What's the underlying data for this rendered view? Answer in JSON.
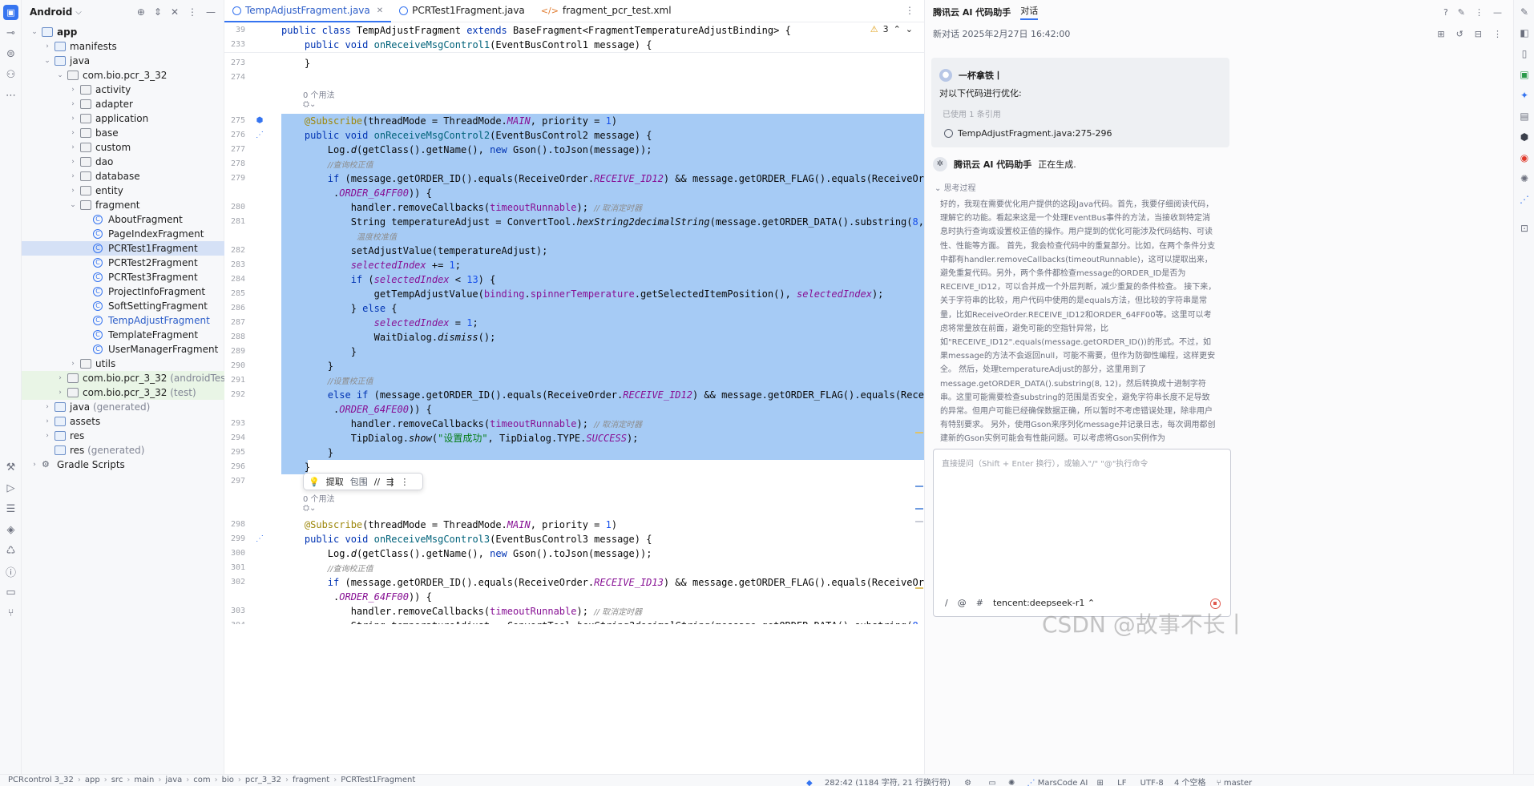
{
  "project": {
    "view_label": "Android",
    "tree": [
      {
        "label": "app",
        "level": 0,
        "kind": "folder",
        "expanded": true,
        "bold": true
      },
      {
        "label": "manifests",
        "level": 1,
        "kind": "folder",
        "expanded": false
      },
      {
        "label": "java",
        "level": 1,
        "kind": "folder",
        "expanded": true
      },
      {
        "label": "com.bio.pcr_3_32",
        "level": 2,
        "kind": "pkg",
        "expanded": true
      },
      {
        "label": "activity",
        "level": 3,
        "kind": "pkg",
        "expanded": false
      },
      {
        "label": "adapter",
        "level": 3,
        "kind": "pkg",
        "expanded": false
      },
      {
        "label": "application",
        "level": 3,
        "kind": "pkg",
        "expanded": false
      },
      {
        "label": "base",
        "level": 3,
        "kind": "pkg",
        "expanded": false
      },
      {
        "label": "custom",
        "level": 3,
        "kind": "pkg",
        "expanded": false
      },
      {
        "label": "dao",
        "level": 3,
        "kind": "pkg",
        "expanded": false
      },
      {
        "label": "database",
        "level": 3,
        "kind": "pkg",
        "expanded": false
      },
      {
        "label": "entity",
        "level": 3,
        "kind": "pkg",
        "expanded": false
      },
      {
        "label": "fragment",
        "level": 3,
        "kind": "pkg",
        "expanded": true
      },
      {
        "label": "AboutFragment",
        "level": 4,
        "kind": "class"
      },
      {
        "label": "PageIndexFragment",
        "level": 4,
        "kind": "class"
      },
      {
        "label": "PCRTest1Fragment",
        "level": 4,
        "kind": "class",
        "selected": true
      },
      {
        "label": "PCRTest2Fragment",
        "level": 4,
        "kind": "class"
      },
      {
        "label": "PCRTest3Fragment",
        "level": 4,
        "kind": "class"
      },
      {
        "label": "ProjectInfoFragment",
        "level": 4,
        "kind": "class"
      },
      {
        "label": "SoftSettingFragment",
        "level": 4,
        "kind": "class"
      },
      {
        "label": "TempAdjustFragment",
        "level": 4,
        "kind": "class",
        "blue": true
      },
      {
        "label": "TemplateFragment",
        "level": 4,
        "kind": "class"
      },
      {
        "label": "UserManagerFragment",
        "level": 4,
        "kind": "class"
      },
      {
        "label": "utils",
        "level": 3,
        "kind": "pkg",
        "expanded": false
      },
      {
        "label": "com.bio.pcr_3_32",
        "suffix": "(androidTest)",
        "level": 2,
        "kind": "pkg",
        "expanded": false,
        "green": true
      },
      {
        "label": "com.bio.pcr_3_32",
        "suffix": "(test)",
        "level": 2,
        "kind": "pkg",
        "expanded": false,
        "green": true
      },
      {
        "label": "java",
        "suffix": "(generated)",
        "level": 1,
        "kind": "folder",
        "expanded": false
      },
      {
        "label": "assets",
        "level": 1,
        "kind": "folder",
        "expanded": false
      },
      {
        "label": "res",
        "level": 1,
        "kind": "folder",
        "expanded": false
      },
      {
        "label": "res",
        "suffix": "(generated)",
        "level": 1,
        "kind": "folder",
        "noarrow": true
      },
      {
        "label": "Gradle Scripts",
        "level": 0,
        "kind": "gradle",
        "expanded": false
      }
    ]
  },
  "editor": {
    "tabs": [
      {
        "label": "TempAdjustFragment.java",
        "active": true,
        "icon": "class"
      },
      {
        "label": "PCRTest1Fragment.java",
        "active": false,
        "icon": "class"
      },
      {
        "label": "fragment_pcr_test.xml",
        "active": false,
        "icon": "xml"
      }
    ],
    "warnings": "3",
    "sticky": [
      {
        "ln": "39",
        "html": "<span class=\"k\">public class</span> TempAdjustFragment <span class=\"k\">extends</span> BaseFragment&lt;FragmentTemperatureAdjustBinding&gt; {"
      },
      {
        "ln": "233",
        "html": "    <span class=\"k\">public void</span> <span class=\"f\">onReceiveMsgControl1</span>(EventBusControl1 message) {"
      }
    ],
    "usage_hint": "0 个用法",
    "popup": {
      "extract": "提取",
      "surround": "包围"
    },
    "lines": [
      {
        "ln": "273",
        "html": "    }"
      },
      {
        "ln": "274",
        "html": ""
      },
      {
        "ln": "275",
        "html": "    <span class=\"a\">@Subscribe</span>(threadMode = ThreadMode.<span class=\"pu\">MAIN</span>, priority = <span class=\"n\">1</span>)"
      },
      {
        "ln": "276",
        "html": "    <span class=\"k\">public void</span> <span class=\"f\">onReceiveMsgControl2</span>(EventBusControl2 message) {"
      },
      {
        "ln": "277",
        "html": "        Log.<span class=\"it\">d</span>(getClass().getName(), <span class=\"k\">new</span> Gson().toJson(message));"
      },
      {
        "ln": "278",
        "html": "        <span class=\"cmz\">//查询校正值</span>"
      },
      {
        "ln": "279",
        "html": "        <span class=\"k\">if</span> (message.getORDER_ID().equals(ReceiveOrder.<span class=\"pu\">RECEIVE_ID12</span>) &amp;&amp; message.getORDER_FLAG().equals(ReceiveOrder"
      },
      {
        "ln": "",
        "html": "         .<span class=\"pu\">ORDER_64FF00</span>)) {"
      },
      {
        "ln": "280",
        "html": "            handler.removeCallbacks(<span class=\"pu\" style=\"font-style:normal\">timeoutRunnable</span>); <span class=\"cmz\">// 取消定时器</span>"
      },
      {
        "ln": "281",
        "html": "            String temperatureAdjust = ConvertTool.<span class=\"it\">hexString2decimalString</span>(message.getORDER_DATA().substring(<span class=\"n\">8</span>, <span class=\"n\">12</span>));<span class=\"cm\">//</span>"
      },
      {
        "ln": "",
        "html": "             <span class=\"cmz\">温度校准值</span>"
      },
      {
        "ln": "282",
        "html": "            setAdjustValue(temperatureAdjust);"
      },
      {
        "ln": "283",
        "html": "            <span class=\"pu\">selectedIndex</span> += <span class=\"n\">1</span>;"
      },
      {
        "ln": "284",
        "html": "            <span class=\"k\">if</span> (<span class=\"pu\">selectedIndex</span> &lt; <span class=\"n\">13</span>) {"
      },
      {
        "ln": "285",
        "html": "                getTempAdjustValue(<span class=\"pu\" style=\"font-style:normal\">binding</span>.<span class=\"pu\" style=\"font-style:normal\">spinnerTemperature</span>.getSelectedItemPosition(), <span class=\"pu\">selectedIndex</span>);"
      },
      {
        "ln": "286",
        "html": "            } <span class=\"k\">else</span> {"
      },
      {
        "ln": "287",
        "html": "                <span class=\"pu\">selectedIndex</span> = <span class=\"n\">1</span>;"
      },
      {
        "ln": "288",
        "html": "                WaitDialog.<span class=\"it\">dismiss</span>();"
      },
      {
        "ln": "289",
        "html": "            }"
      },
      {
        "ln": "290",
        "html": "        }"
      },
      {
        "ln": "291",
        "html": "        <span class=\"cmz\">//设置校正值</span>"
      },
      {
        "ln": "292",
        "html": "        <span class=\"k\">else if</span> (message.getORDER_ID().equals(ReceiveOrder.<span class=\"pu\">RECEIVE_ID12</span>) &amp;&amp; message.getORDER_FLAG().equals(ReceiveOrder"
      },
      {
        "ln": "",
        "html": "         .<span class=\"pu\">ORDER_64FE00</span>)) {"
      },
      {
        "ln": "293",
        "html": "            handler.removeCallbacks(<span class=\"pu\" style=\"font-style:normal\">timeoutRunnable</span>); <span class=\"cmz\">// 取消定时器</span>"
      },
      {
        "ln": "294",
        "html": "            TipDialog.<span class=\"it\">show</span>(<span class=\"s\">\"设置成功\"</span>, TipDialog.TYPE.<span class=\"pu\">SUCCESS</span>);"
      },
      {
        "ln": "295",
        "html": "        }"
      },
      {
        "ln": "296",
        "html": "    }"
      },
      {
        "ln": "297",
        "html": ""
      },
      {
        "ln": "298",
        "html": "    <span class=\"a\">@Subscribe</span>(threadMode = ThreadMode.<span class=\"pu\">MAIN</span>, priority = <span class=\"n\">1</span>)"
      },
      {
        "ln": "299",
        "html": "    <span class=\"k\">public void</span> <span class=\"f\">onReceiveMsgControl3</span>(EventBusControl3 message) {"
      },
      {
        "ln": "300",
        "html": "        Log.<span class=\"it\">d</span>(getClass().getName(), <span class=\"k\">new</span> Gson().toJson(message));"
      },
      {
        "ln": "301",
        "html": "        <span class=\"cmz\">//查询校正值</span>"
      },
      {
        "ln": "302",
        "html": "        <span class=\"k\">if</span> (message.getORDER_ID().equals(ReceiveOrder.<span class=\"pu\">RECEIVE_ID13</span>) &amp;&amp; message.getORDER_FLAG().equals(ReceiveOrder"
      },
      {
        "ln": "",
        "html": "         .<span class=\"pu\">ORDER_64FF00</span>)) {"
      },
      {
        "ln": "303",
        "html": "            handler.removeCallbacks(<span class=\"pu\" style=\"font-style:normal\">timeoutRunnable</span>); <span class=\"cmz\">// 取消定时器</span>"
      },
      {
        "ln": "304",
        "html": "            String temperatureAdjust = ConvertTool.<span class=\"it\">hexString2decimalString</span>(message.getORDER_DATA().substring(<span class=\"n\">8</span>, <span class=\"n\">12</span>));<span class=\"cm\">//</span>"
      }
    ]
  },
  "assistant": {
    "title": "腾讯云 AI 代码助手",
    "tab": "对话",
    "session": "新对话 2025年2月27日 16:42:00",
    "user_name": "一杯拿铁丨",
    "user_text": "对以下代码进行优化:",
    "ref_count": "已使用 1 条引用",
    "ref_file": "TempAdjustFragment.java:275-296",
    "bot_name": "腾讯云 AI 代码助手",
    "bot_status": "正在生成.",
    "think_label": "思考过程",
    "think_text": "好的，我现在需要优化用户提供的这段Java代码。首先，我要仔细阅读代码，理解它的功能。看起来这是一个处理EventBus事件的方法，当接收到特定消息时执行查询或设置校正值的操作。用户提到的优化可能涉及代码结构、可读性、性能等方面。 首先，我会检查代码中的重复部分。比如，在两个条件分支中都有handler.removeCallbacks(timeoutRunnable)，这可以提取出来，避免重复代码。另外，两个条件都检查message的ORDER_ID是否为RECEIVE_ID12，可以合并成一个外层判断，减少重复的条件检查。 接下来，关于字符串的比较，用户代码中使用的是equals方法，但比较的字符串是常量，比如ReceiveOrder.RECEIVE_ID12和ORDER_64FF00等。这里可以考虑将常量放在前面，避免可能的空指针异常，比如\"RECEIVE_ID12\".equals(message.getORDER_ID())的形式。不过，如果message的方法不会返回null，可能不需要，但作为防御性编程，这样更安全。 然后，处理temperatureAdjust的部分，这里用到了message.getORDER_DATA().substring(8, 12)，然后转换成十进制字符串。这里可能需要检查substring的范围是否安全，避免字符串长度不足导致的异常。但用户可能已经确保数据正确，所以暂时不考虑错误处理，除非用户有特别要求。 另外，使用Gson来序列化message并记录日志，每次调用都创建新的Gson实例可能会有性能问题。可以考虑将Gson实例作为",
    "input_placeholder": "直接提问（Shift + Enter 换行），或输入\"/\" \"@\"执行命令",
    "model": "tencent:deepseek-r1"
  },
  "status": {
    "crumbs": [
      "PCRcontrol 3_32",
      "app",
      "src",
      "main",
      "java",
      "com",
      "bio",
      "pcr_3_32",
      "fragment",
      "PCRTest1Fragment"
    ],
    "position": "282:42 (1184 字符, 21 行换行符)",
    "marscode": "MarsCode AI",
    "line_sep": "LF",
    "encoding": "UTF-8",
    "indent": "4 个空格",
    "branch": "master"
  },
  "watermark": "CSDN @故事不长丨"
}
